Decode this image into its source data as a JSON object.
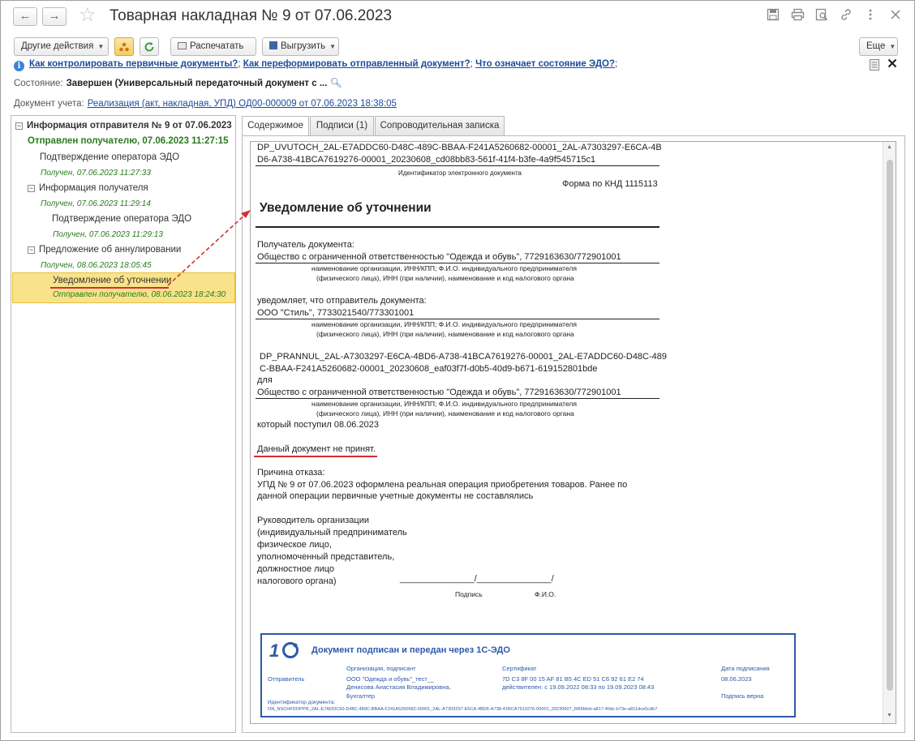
{
  "window": {
    "title": "Товарная накладная № 9 от 07.06.2023",
    "back": "←",
    "forward": "→",
    "star": "☆",
    "icons": [
      "save-icon",
      "print-icon",
      "preview-icon",
      "link-icon",
      "more-icon",
      "close-icon"
    ]
  },
  "toolbar": {
    "other_actions": "Другие действия",
    "print": "Распечатать",
    "export": "Выгрузить",
    "more": "Еще"
  },
  "help_links": {
    "link1": "Как контролировать первичные документы?",
    "link2": "Как переформировать отправленный документ?",
    "link3": "Что означает состояние ЭДО?",
    "sep": ";"
  },
  "state": {
    "label": "Состояние:",
    "value": "Завершен (Универсальный передаточный документ с ..."
  },
  "doc_ref": {
    "label": "Документ учета:",
    "value": "Реализация (акт, накладная, УПД) ОД00-000009 от 07.06.2023 18:38:05"
  },
  "tree": {
    "root": "Информация отправителя № 9 от 07.06.2023",
    "root_status": "Отправлен получателю, 07.06.2023 11:27:15",
    "n1": "Подтверждение оператора ЭДО",
    "n1_status": "Получен, 07.06.2023 11:27:33",
    "n2": "Информация получателя",
    "n2_status": "Получен, 07.06.2023 11:29:14",
    "n3": "Подтверждение оператора ЭДО",
    "n3_status": "Получен, 07.06.2023 11:29:13",
    "n4": "Предложение об аннулировании",
    "n4_status": "Получен, 08.06.2023 18:05:45",
    "n5": "Уведомление об уточнении",
    "n5_status": "Отправлен получателю, 08.06.2023 18:24:30"
  },
  "tabs": {
    "content": "Содержимое",
    "signatures": "Подписи (1)",
    "note": "Сопроводительная записка"
  },
  "document": {
    "id_line1": "DP_UVUTOCH_2AL-E7ADDC60-D48C-489C-BBAA-F241A5260682-00001_2AL-A7303297-E6CA-4B",
    "id_line2": "D6-A738-41BCA7619276-00001_20230608_cd08bb83-561f-41f4-b3fe-4a9f545715c1",
    "id_caption": "Идентификатор электронного документа",
    "form": "Форма по КНД 1115113",
    "heading": "Уведомление об уточнении",
    "recipient_label": "Получатель документа:",
    "recipient": "Общество с ограниченной ответственностью \"Одежда и обувь\", 7729163630/772901001",
    "cap1a": "наименование организации, ИНН/КПП; Ф.И.О. индивидуального предпринимателя",
    "cap1b": "(физического лица), ИНН (при наличии), наименование и код налогового органа",
    "notifies": "уведомляет, что отправитель документа:",
    "sender": "ООО \"Стиль\", 7733021540/773301001",
    "cap2a": "наименование организации, ИНН/КПП; Ф.И.О. индивидуального предпринимателя",
    "cap2b": "(физического лица), ИНН (при наличии), наименование и код налогового органа",
    "ref1": "DP_PRANNUL_2AL-A7303297-E6CA-4BD6-A738-41BCA7619276-00001_2AL-E7ADDC60-D48C-489",
    "ref2": "C-BBAA-F241A5260682-00001_20230608_eaf03f7f-d0b5-40d9-b671-619152801bde",
    "for": "для",
    "recipient2": "Общество с ограниченной ответственностью \"Одежда и обувь\", 7729163630/772901001",
    "cap3a": "наименование организации, ИНН/КПП; Ф.И.О. индивидуального предпринимателя",
    "cap3b": "(физического лица), ИНН (при наличии), наименование и код налогового органа",
    "received": "который поступил 08.06.2023",
    "not_accepted": "Данный документ не принят.",
    "reason_label": "Причина отказа:",
    "reason1": "УПД № 9 от 07.06.2023 оформлена реальная операция приобретения товаров. Ранее по",
    "reason2": "данной операции первичные учетные документы не составлялись",
    "sig1": "Руководитель  организации",
    "sig2": "(индивидуальный предприниматель",
    "sig3": "физическое лицо,",
    "sig4": "уполномоченный представитель,",
    "sig5": "должностное лицо",
    "sig6": "налогового органа)",
    "sig_lines": "_______________/_______________/",
    "sig_cap_sign": "Подпись",
    "sig_cap_name": "Ф.И.О."
  },
  "stamp": {
    "logo": "1С",
    "title": "Документ подписан и передан через 1С-ЭДО",
    "col_org": "Организация, подписант",
    "col_cert": "Сертификат",
    "col_date": "Дата подписания",
    "row_label": "Отправитель",
    "org1": "ООО \"Одежда и обувь\"_тест__",
    "org2": "Денисова Анастасия Владимировна,",
    "org3": "Бухгалтер",
    "cert1": "7D C3 8F 00 15 AF 81 B5 4C ED 51 C6 92 61 E2 74",
    "cert2": "действителен: с 19.09.2022 08:33 по 19.09.2023 08:43",
    "date": "08.06.2023",
    "sign_ok": "Подпись верна",
    "id_label": "Идентификатор документа:",
    "id_value": "ON_NSCHFDOPPR_2AL-E7ADDC60-D48C-489C-BBAA-F241A5260682-00001_2AL-A7303297-E6CA-4BD6-A738-41BCA7619276-00001_20230607_6f66fdeb-a817-40dc-b73e-a811dce5cdb7"
  }
}
